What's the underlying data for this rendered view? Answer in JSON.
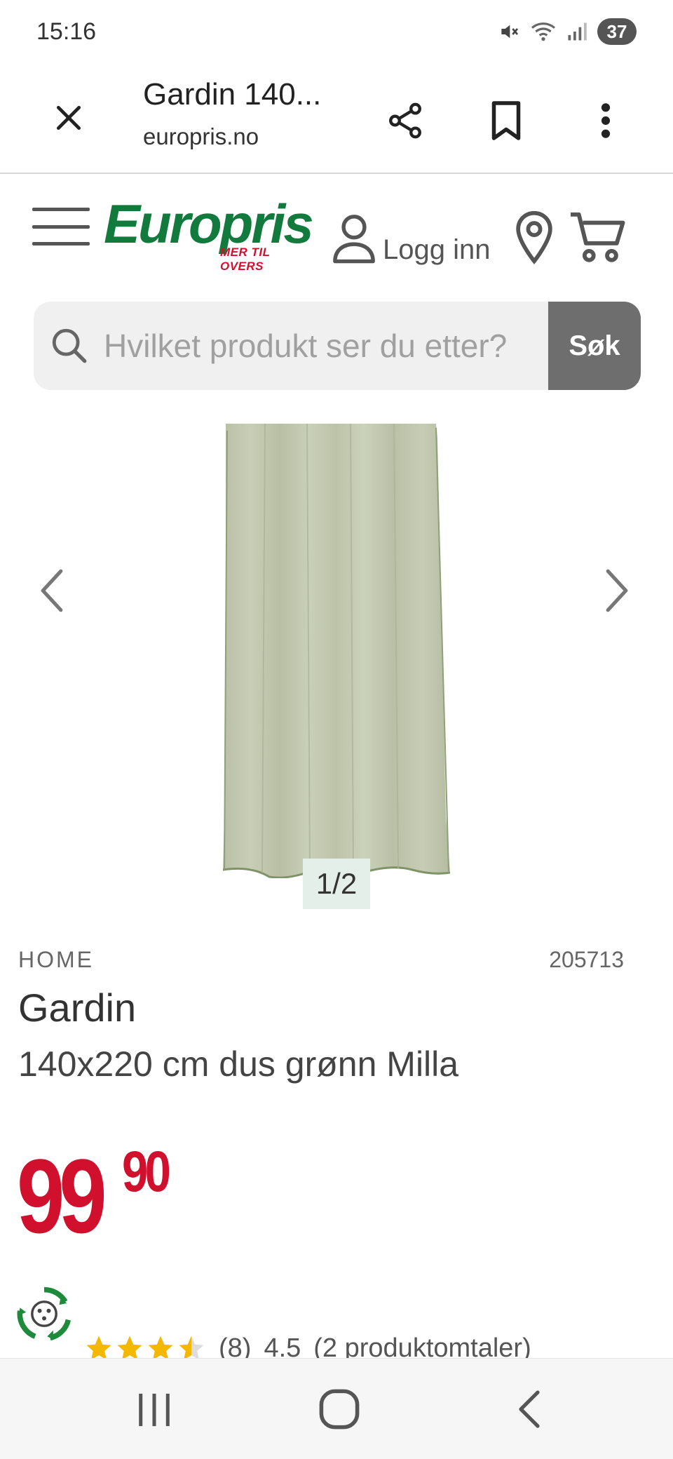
{
  "status_bar": {
    "time": "15:16",
    "battery": "37",
    "icons": [
      "mute-icon",
      "wifi-icon",
      "signal-icon",
      "battery-icon"
    ]
  },
  "tab": {
    "title": "Gardin 140...",
    "url": "europris.no",
    "icons": [
      "close-icon",
      "share-icon",
      "bookmark-icon",
      "more-icon"
    ]
  },
  "site_header": {
    "logo_text": "Europris",
    "logo_tagline": "MER TIL OVERS",
    "login_label": "Logg inn",
    "brand_colors": {
      "green": "#137a3d",
      "red": "#d0102c"
    }
  },
  "search": {
    "placeholder": "Hvilket produkt ser du etter?",
    "button_label": "Søk"
  },
  "gallery": {
    "counter": "1/2",
    "current_index": 1,
    "total_images": 2
  },
  "product": {
    "brand": "HOME",
    "sku": "205713",
    "title": "Gardin",
    "subtitle": "140x220 cm dus grønn Milla",
    "price_integer": "99",
    "price_decimal": "90",
    "price_color": "#d0102c"
  },
  "rating": {
    "stars_value": 3.5,
    "count_label": "(8)",
    "score": "4.5",
    "reviews_label": "(2 produktomtaler)"
  },
  "nav_bar": {
    "icons": [
      "recents-icon",
      "home-icon",
      "back-icon"
    ]
  }
}
